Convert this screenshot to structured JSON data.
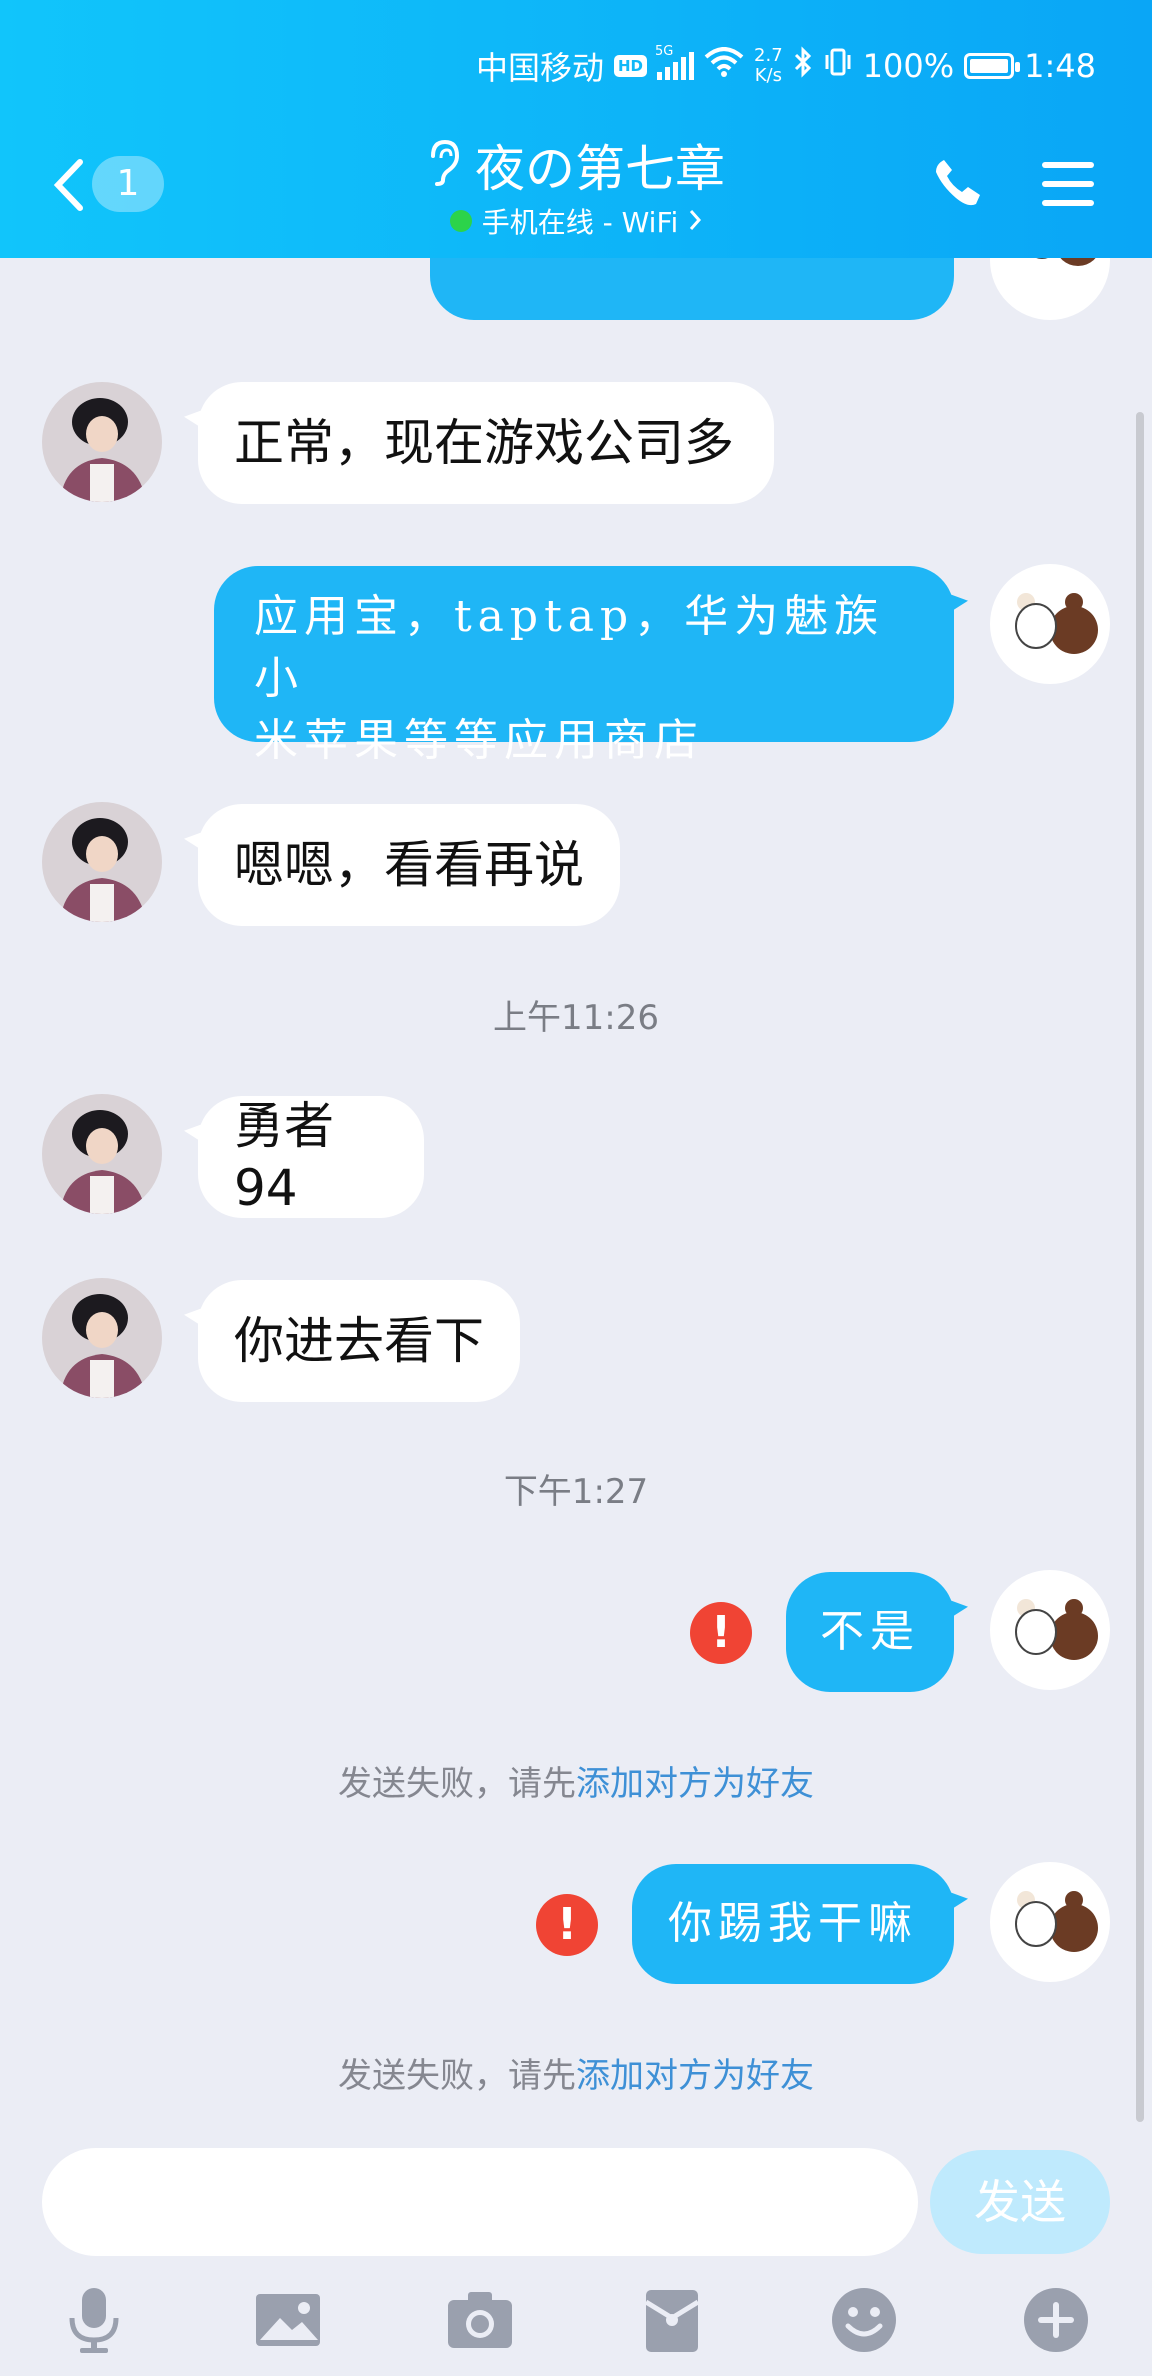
{
  "status_bar": {
    "carrier": "中国移动",
    "hd": "HD",
    "network_tag": "5G",
    "net_speed_value": "2.7",
    "net_speed_unit": "K/s",
    "battery": "100%",
    "battery_level": 1.0,
    "time": "1:48"
  },
  "header": {
    "unread_count": "1",
    "title": "夜の第七章",
    "subtitle": "手机在线 - WiFi"
  },
  "messages": [
    {
      "side": "right",
      "text": "",
      "partial": true
    },
    {
      "side": "left",
      "text": "正常，现在游戏公司多"
    },
    {
      "side": "right",
      "text": "应用宝，taptap，华为魅族小米苹果等等应用商店"
    },
    {
      "side": "left",
      "text": "嗯嗯，看看再说"
    },
    {
      "timestamp": "上午11:26"
    },
    {
      "side": "left",
      "text": "勇者94"
    },
    {
      "side": "left",
      "text": "你进去看下"
    },
    {
      "timestamp": "下午1:27"
    },
    {
      "side": "right",
      "text": "不是",
      "failed": true
    },
    {
      "side": "right",
      "text": "你踢我干嘛",
      "failed": true
    }
  ],
  "chat": {
    "msg1": "正常，现在游戏公司多",
    "msg2_line1": "应用宝，taptap，华为魅族小",
    "msg2_line2": "米苹果等等应用商店",
    "msg3": "嗯嗯，看看再说",
    "ts1": "上午11:26",
    "msg4": "勇者94",
    "msg5": "你进去看下",
    "ts2": "下午1:27",
    "msg6": "不是",
    "msg7": "你踢我干嘛",
    "fail_prefix": "发送失败，请先",
    "fail_link": "添加对方为好友",
    "error_mark": "!"
  },
  "input": {
    "placeholder": "",
    "send_label": "发送"
  },
  "toolbar_icons": [
    "microphone-icon",
    "image-icon",
    "camera-icon",
    "red-packet-icon",
    "emoji-icon",
    "plus-icon"
  ],
  "colors": {
    "header": "#0aa6f6",
    "my_bubble": "#1fb6f6",
    "error": "#f04434",
    "link": "#3e90d6"
  }
}
